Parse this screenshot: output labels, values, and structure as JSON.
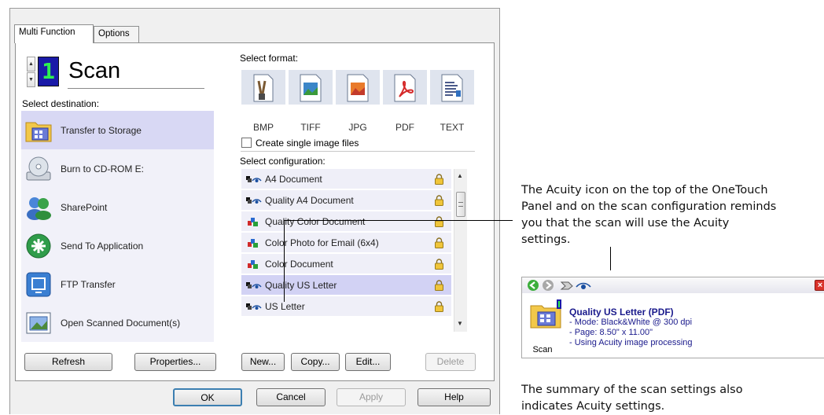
{
  "dialog": {
    "tabs": [
      "Multi Function",
      "Options"
    ],
    "scan_number": "1",
    "scan_title": "Scan",
    "select_destination_label": "Select destination:",
    "destinations": [
      "Transfer to Storage",
      "Burn to CD-ROM  E:",
      "SharePoint",
      "Send To Application",
      "FTP Transfer",
      "Open Scanned Document(s)"
    ],
    "selected_destination": 0,
    "select_format_label": "Select format:",
    "formats": [
      "BMP",
      "TIFF",
      "JPG",
      "PDF",
      "TEXT"
    ],
    "single_image_label": "Create single image files",
    "single_image_checked": false,
    "select_configuration_label": "Select configuration:",
    "configurations": [
      {
        "label": "A4 Document",
        "icon": "acuity-bw"
      },
      {
        "label": "Quality A4 Document",
        "icon": "acuity-bw"
      },
      {
        "label": "Quality Color Document",
        "icon": "color"
      },
      {
        "label": "Color Photo for Email (6x4)",
        "icon": "color"
      },
      {
        "label": "Color Document",
        "icon": "color"
      },
      {
        "label": "Quality US Letter",
        "icon": "acuity-bw"
      },
      {
        "label": "US Letter",
        "icon": "acuity-bw"
      }
    ],
    "selected_configuration": 5,
    "buttons": {
      "refresh": "Refresh",
      "properties": "Properties...",
      "new": "New...",
      "copy": "Copy...",
      "edit": "Edit...",
      "delete": "Delete",
      "ok": "OK",
      "cancel": "Cancel",
      "apply": "Apply",
      "help": "Help"
    }
  },
  "annotations": {
    "top": [
      "The Acuity icon on the top of the OneTouch",
      "Panel and on the scan configuration reminds",
      "you that the scan will use the Acuity",
      "settings."
    ],
    "bottom": [
      "The summary of the scan settings also",
      "indicates Acuity settings."
    ]
  },
  "onetouch_panel": {
    "scan_label": "Scan",
    "summary_title": "Quality US Letter (PDF)",
    "summary_lines": [
      "- Mode: Black&White @ 300 dpi",
      "- Page:  8.50\" x 11.00\"",
      "- Using Acuity image processing"
    ]
  },
  "colors": {
    "selection": "#d2d2f4",
    "list_bg": "#efeff8",
    "lcd_bg": "#1a1aa8",
    "lcd_digit": "#2df050",
    "summary_title": "#1a1a8c",
    "close_red": "#d9332b",
    "nav_green": "#3cae3c"
  },
  "icons": [
    "spin-up-icon",
    "spin-down-icon",
    "folder-storage-icon",
    "cd-rom-icon",
    "sharepoint-icon",
    "send-app-icon",
    "ftp-icon",
    "open-doc-icon",
    "bmp-icon",
    "tiff-icon",
    "jpg-icon",
    "pdf-icon",
    "text-icon",
    "acuity-eye-icon",
    "color-icon",
    "lock-icon",
    "back-icon",
    "forward-icon",
    "close-icon"
  ]
}
